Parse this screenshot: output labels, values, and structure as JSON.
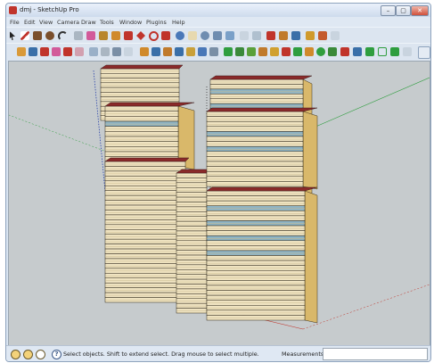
{
  "window": {
    "title": "dmj - SketchUp Pro",
    "controls": {
      "minimize": "–",
      "maximize": "▢",
      "close": "✕"
    }
  },
  "menu": [
    "File",
    "Edit",
    "View",
    "Camera",
    "Draw",
    "Tools",
    "Window",
    "Plugins",
    "Help"
  ],
  "status": {
    "text": "Select objects. Shift to extend select. Drag mouse to select multiple.",
    "help_icon": "?",
    "measurements_label": "Measurements",
    "measurements_value": ""
  },
  "icons": {
    "status": [
      "geo-location-icon",
      "credits-icon",
      "user-icon"
    ]
  },
  "colors": {
    "viewport_bg": "#c6cbcd",
    "facade": "#efe3c1",
    "side_wall": "#d9b86a",
    "roof": "#8a2a2a",
    "window_band": "#8fb4c4",
    "axis_green": "#2f9e3f",
    "axis_red": "#c0342b",
    "axis_blue": "#2640a8"
  }
}
